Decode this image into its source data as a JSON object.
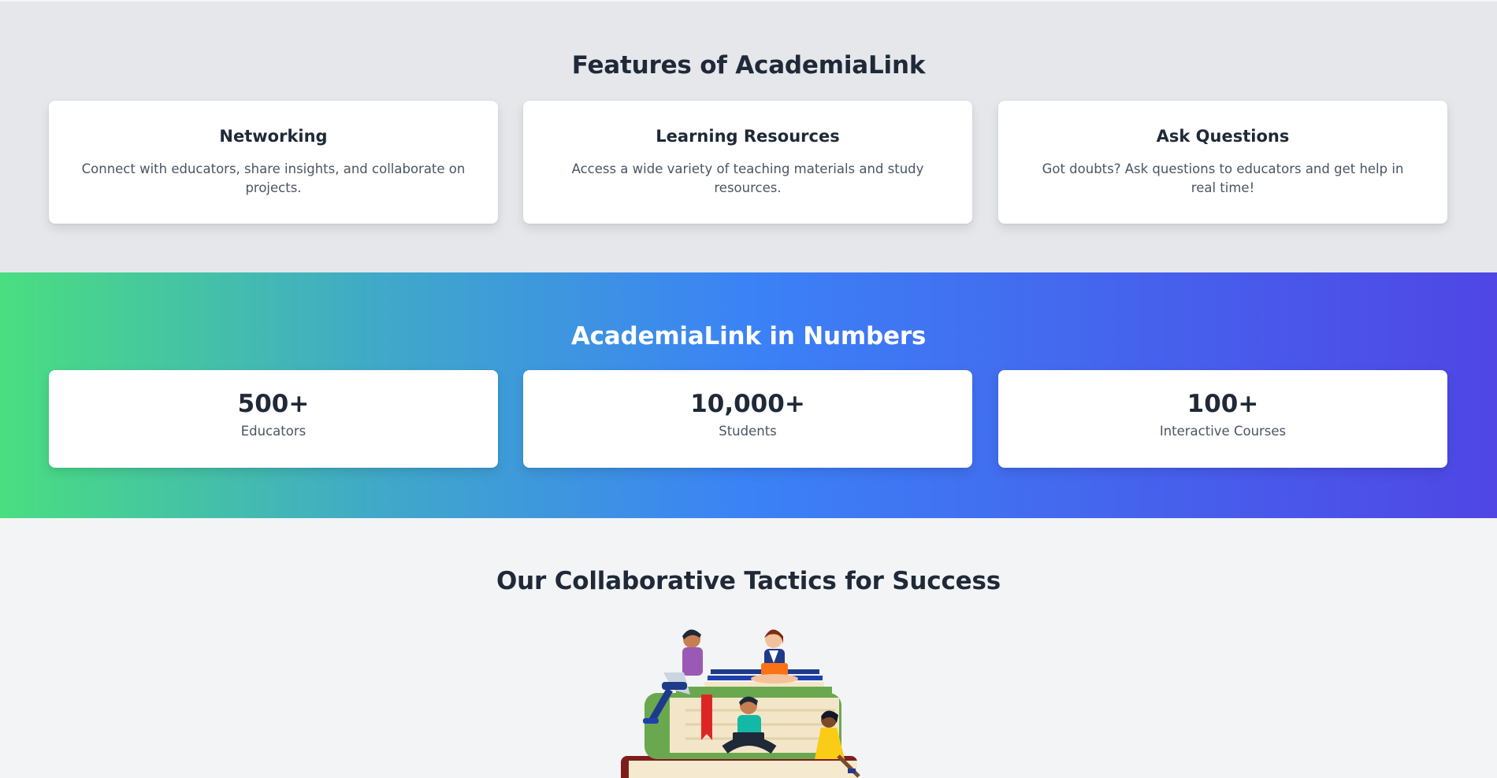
{
  "features": {
    "title": "Features of AcademiaLink",
    "cards": [
      {
        "title": "Networking",
        "description": "Connect with educators, share insights, and collaborate on projects."
      },
      {
        "title": "Learning Resources",
        "description": "Access a wide variety of teaching materials and study resources."
      },
      {
        "title": "Ask Questions",
        "description": "Got doubts? Ask questions to educators and get help in real time!"
      }
    ]
  },
  "numbers": {
    "title": "AcademiaLink in Numbers",
    "stats": [
      {
        "value": "500+",
        "label": "Educators"
      },
      {
        "value": "10,000+",
        "label": "Students"
      },
      {
        "value": "100+",
        "label": "Interactive Courses"
      }
    ]
  },
  "tactics": {
    "title": "Our Collaborative Tactics for Success",
    "illustration": "students-on-books-illustration"
  },
  "colors": {
    "features_bg": "#e5e7eb",
    "gradient_start": "#4ade80",
    "gradient_mid": "#3b82f6",
    "gradient_end": "#4f46e5",
    "heading_text": "#1f2937",
    "body_text": "#4b5563"
  }
}
